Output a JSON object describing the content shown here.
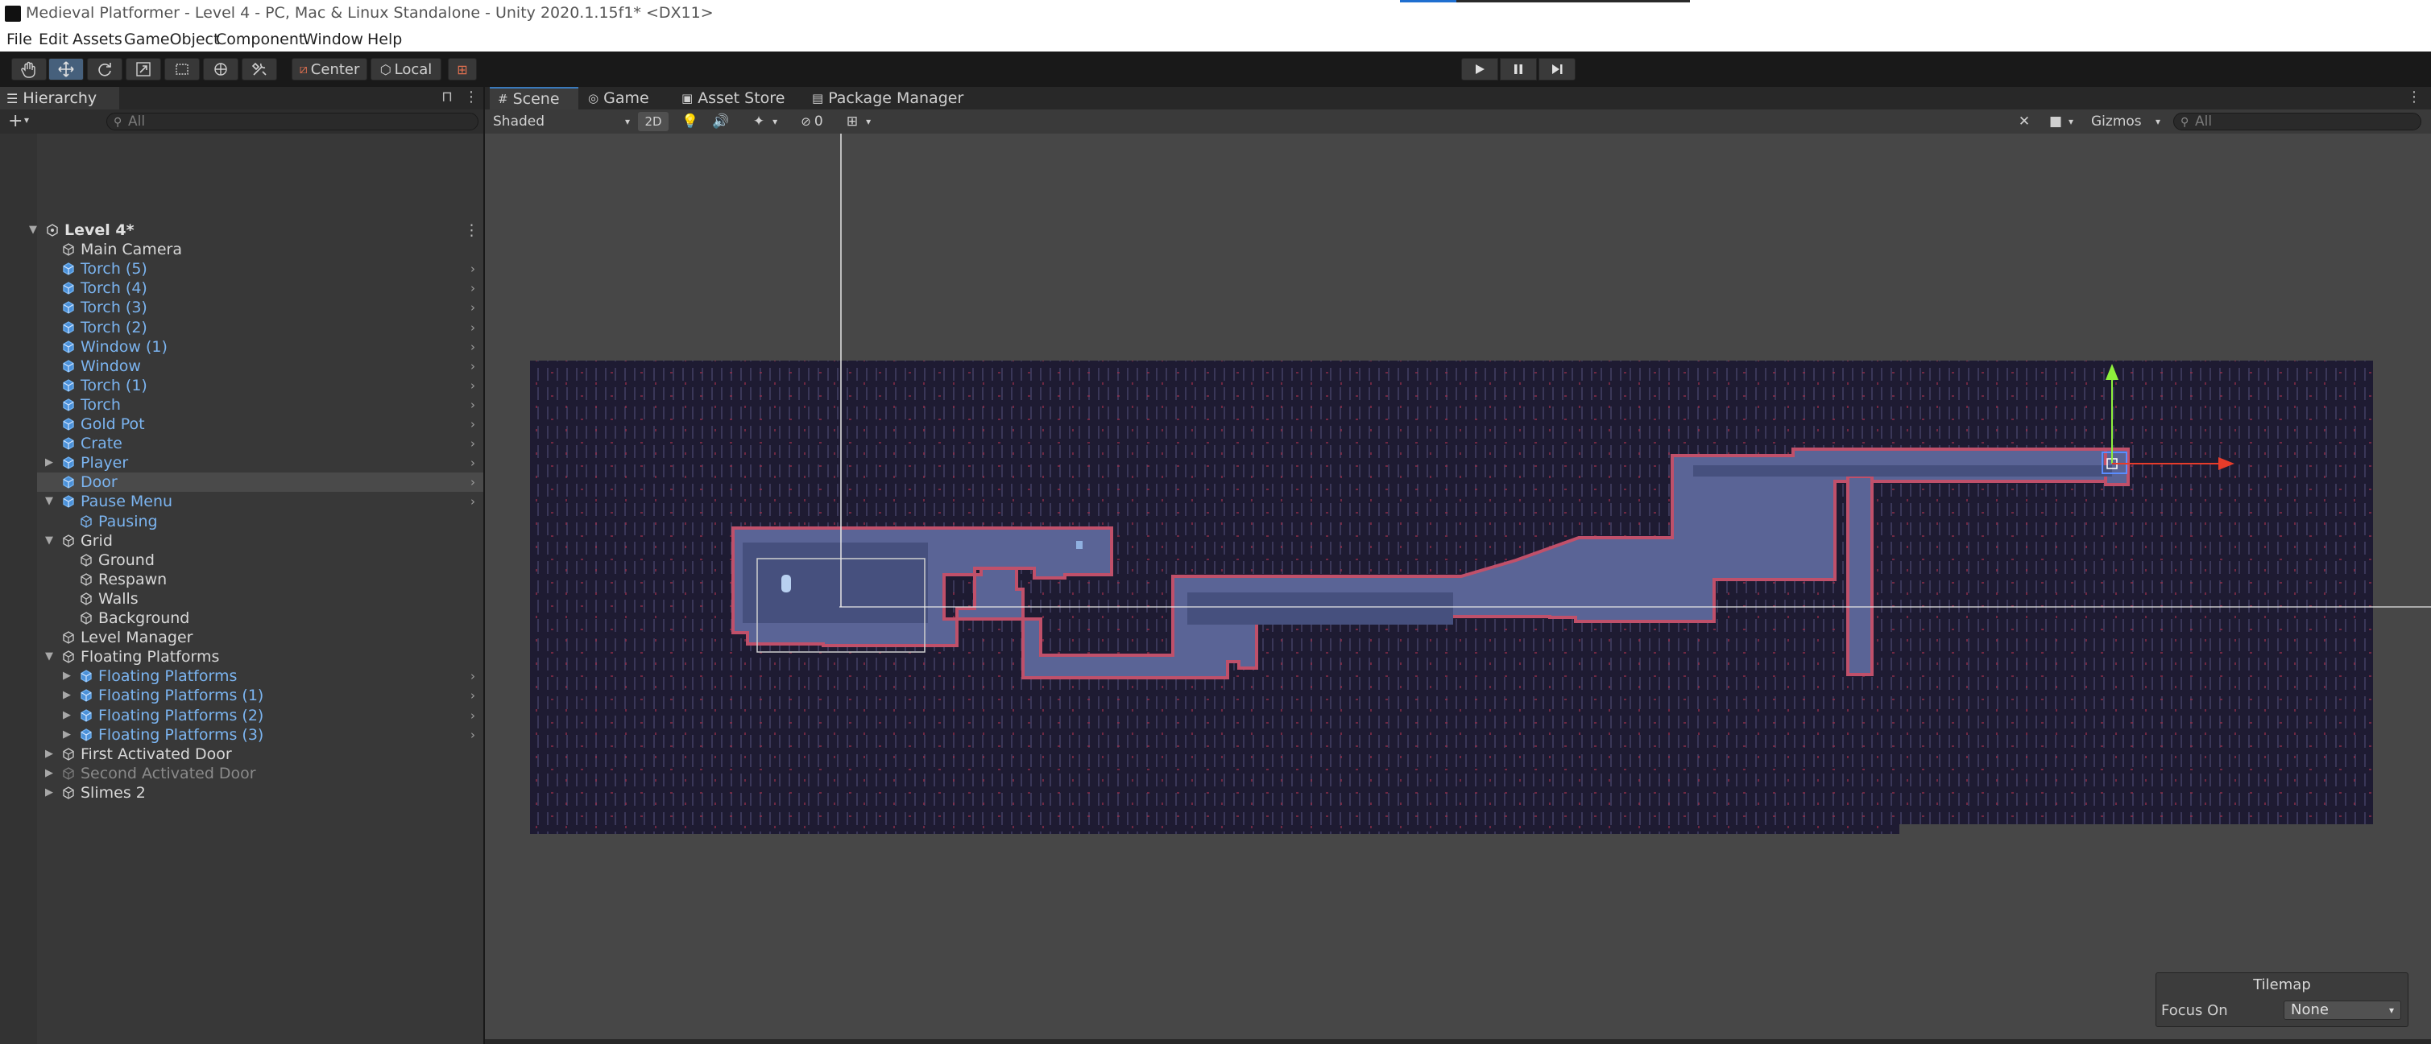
{
  "window": {
    "title": "Medieval Platformer - Level 4 - PC, Mac & Linux Standalone - Unity 2020.1.15f1* <DX11>"
  },
  "menu": [
    "File",
    "Edit",
    "Assets",
    "GameObject",
    "Component",
    "Window",
    "Help"
  ],
  "toolbar": {
    "tools": [
      "hand-tool-icon",
      "move-tool-icon",
      "rotate-tool-icon",
      "scale-tool-icon",
      "rect-tool-icon",
      "transform-tool-icon",
      "custom-tool-icon"
    ],
    "pivot_label": "Center",
    "space_label": "Local",
    "playback": [
      "play-icon",
      "pause-icon",
      "step-icon"
    ]
  },
  "hierarchy": {
    "tab_label": "Hierarchy",
    "search_placeholder": "All",
    "items": [
      {
        "label": "Level 4*",
        "depth": 0,
        "expand": "open",
        "type": "scene"
      },
      {
        "label": "Main Camera",
        "depth": 1,
        "expand": "none",
        "type": "object"
      },
      {
        "label": "Torch (5)",
        "depth": 1,
        "expand": "none",
        "type": "prefab",
        "chevron": true
      },
      {
        "label": "Torch (4)",
        "depth": 1,
        "expand": "none",
        "type": "prefab",
        "chevron": true
      },
      {
        "label": "Torch (3)",
        "depth": 1,
        "expand": "none",
        "type": "prefab",
        "chevron": true
      },
      {
        "label": "Torch (2)",
        "depth": 1,
        "expand": "none",
        "type": "prefab",
        "chevron": true
      },
      {
        "label": "Window (1)",
        "depth": 1,
        "expand": "none",
        "type": "prefab",
        "chevron": true
      },
      {
        "label": "Window",
        "depth": 1,
        "expand": "none",
        "type": "prefab",
        "chevron": true
      },
      {
        "label": "Torch (1)",
        "depth": 1,
        "expand": "none",
        "type": "prefab",
        "chevron": true
      },
      {
        "label": "Torch",
        "depth": 1,
        "expand": "none",
        "type": "prefab",
        "chevron": true
      },
      {
        "label": "Gold Pot",
        "depth": 1,
        "expand": "none",
        "type": "prefab",
        "chevron": true
      },
      {
        "label": "Crate",
        "depth": 1,
        "expand": "none",
        "type": "prefab",
        "chevron": true
      },
      {
        "label": "Player",
        "depth": 1,
        "expand": "closed",
        "type": "prefab",
        "chevron": true
      },
      {
        "label": "Door",
        "depth": 1,
        "expand": "none",
        "type": "prefab",
        "chevron": true,
        "selected": true
      },
      {
        "label": "Pause Menu",
        "depth": 1,
        "expand": "open",
        "type": "prefab",
        "chevron": true
      },
      {
        "label": "Pausing",
        "depth": 2,
        "expand": "none",
        "type": "object-blue"
      },
      {
        "label": "Grid",
        "depth": 1,
        "expand": "open",
        "type": "object"
      },
      {
        "label": "Ground",
        "depth": 2,
        "expand": "none",
        "type": "object"
      },
      {
        "label": "Respawn",
        "depth": 2,
        "expand": "none",
        "type": "object"
      },
      {
        "label": "Walls",
        "depth": 2,
        "expand": "none",
        "type": "object"
      },
      {
        "label": "Background",
        "depth": 2,
        "expand": "none",
        "type": "object"
      },
      {
        "label": "Level Manager",
        "depth": 1,
        "expand": "none",
        "type": "object"
      },
      {
        "label": "Floating Platforms",
        "depth": 1,
        "expand": "open",
        "type": "object"
      },
      {
        "label": "Floating Platforms",
        "depth": 2,
        "expand": "closed",
        "type": "prefab",
        "chevron": true
      },
      {
        "label": "Floating Platforms (1)",
        "depth": 2,
        "expand": "closed",
        "type": "prefab",
        "chevron": true
      },
      {
        "label": "Floating Platforms (2)",
        "depth": 2,
        "expand": "closed",
        "type": "prefab",
        "chevron": true
      },
      {
        "label": "Floating Platforms (3)",
        "depth": 2,
        "expand": "closed",
        "type": "prefab",
        "chevron": true
      },
      {
        "label": "First Activated Door",
        "depth": 1,
        "expand": "closed",
        "type": "object"
      },
      {
        "label": "Second Activated Door",
        "depth": 1,
        "expand": "closed",
        "type": "object-dim"
      },
      {
        "label": "Slimes 2",
        "depth": 1,
        "expand": "closed",
        "type": "object"
      }
    ]
  },
  "scene": {
    "tabs": [
      "Scene",
      "Game",
      "Asset Store",
      "Package Manager"
    ],
    "active_tab": "Scene",
    "draw_mode": "Shaded",
    "mode_2d_label": "2D",
    "hidden_count": "0",
    "gizmos_label": "Gizmos",
    "search_placeholder": "All",
    "colors": {
      "background_tiles": "#1e1b32",
      "platform": "#5a6496",
      "platform_edge": "#c0506a",
      "gizmo_x": "#e83c2a",
      "gizmo_y": "#8ef03c"
    }
  },
  "tilemap": {
    "title": "Tilemap",
    "focus_label": "Focus On",
    "focus_value": "None"
  }
}
